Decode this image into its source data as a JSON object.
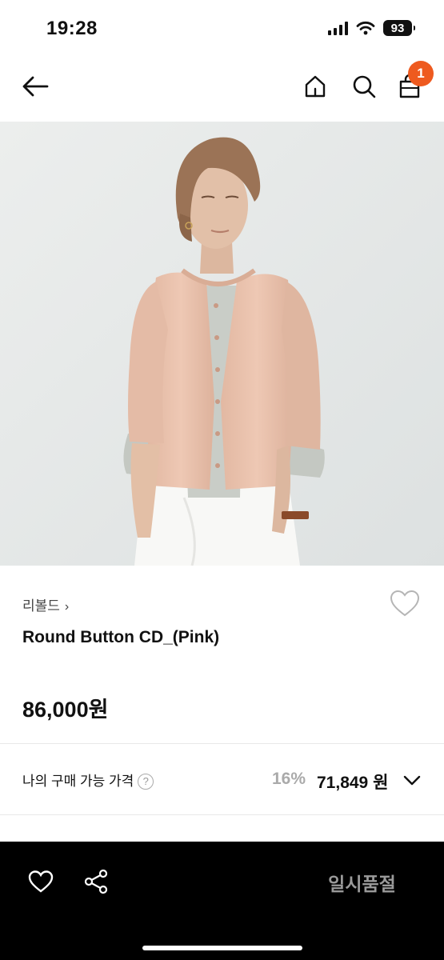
{
  "status_bar": {
    "time": "19:28",
    "battery": "93"
  },
  "top_nav": {
    "cart_count": "1"
  },
  "product": {
    "brand": "리볼드",
    "brand_chevron": "›",
    "name": "Round Button CD_(Pink)",
    "price": "86,000원"
  },
  "my_price": {
    "label": "나의 구매 가능 가격",
    "help_glyph": "?",
    "discount": "16%",
    "price": "71,849 원"
  },
  "bottom_bar": {
    "action_label": "일시품절"
  },
  "colors": {
    "accent": "#ee5a1f",
    "bottom_bar_bg": "#000000",
    "cardigan": "#e9c1ac",
    "inner_shirt": "#c4c8c2",
    "skirt": "#f8f8f6",
    "hair": "#9b7356",
    "photo_bg": "#e6e8e8"
  },
  "icons": {
    "back": "arrow-left-icon",
    "home": "home-icon",
    "search": "search-icon",
    "cart": "bag-icon",
    "wish": "heart-outline-icon",
    "help": "question-circle-icon",
    "expand": "chevron-down-icon",
    "like": "heart-icon",
    "share": "share-icon"
  }
}
